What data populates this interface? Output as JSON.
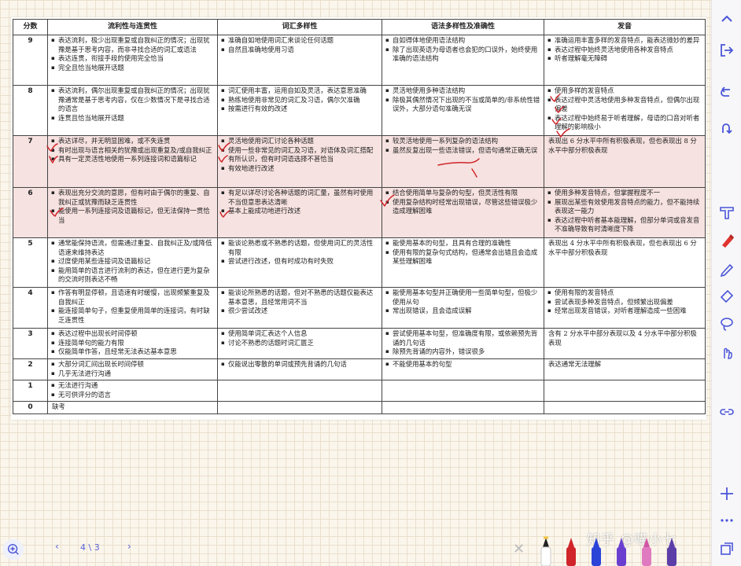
{
  "table": {
    "headers": [
      "分数",
      "流利性与连贯性",
      "词汇多样性",
      "语法多样性及准确性",
      "发音"
    ],
    "rows": [
      {
        "score": "9",
        "highlight": false,
        "fluency": [
          "表达流利，极少出现重复或自我纠正的情况；出现犹豫是基于思考内容，而非寻找合适的词汇或语法",
          "表达连贯，衔接手段的使用完全恰当",
          "完全且恰当地展开话题"
        ],
        "lexical": [
          "准确自如地使用词汇来谈论任何话题",
          "自然且准确地使用习语"
        ],
        "grammar": [
          "自如得体地使用语法结构",
          "除了出现英语为母语者也会犯的口误外，始终使用准确的语法结构"
        ],
        "pron": [
          "准确运用丰富多样的发音特点，能表达微妙的差异",
          "表达过程中始终灵活地使用各种发音特点",
          "听者理解毫无障碍"
        ]
      },
      {
        "score": "8",
        "highlight": false,
        "fluency": [
          "表达流利，偶尔出现重复或自我纠正的情况；出现犹豫通常是基于思考内容，仅在少数情况下是寻找合适的语言",
          "连贯且恰当地展开话题"
        ],
        "lexical": [
          "词汇使用丰富，运用自如及灵活，表达意思准确",
          "熟练地使用非常见的词汇及习语，偶尔欠准确",
          "按需进行有效的改述"
        ],
        "grammar": [
          "灵活地使用多种语法结构",
          "除极其偶然情况下出现的不当或简单的/非系统性错误外，大部分语句准确无误"
        ],
        "pron": [
          "使用多样的发音特点",
          "表达过程中灵活地使用多种发音特点，但偶尔出现偏差",
          "表达过程中始终易于听者理解，母语的口音对听者理解的影响极小"
        ]
      },
      {
        "score": "7",
        "highlight": true,
        "fluency": [
          "表达详尽，并无明显困难，或不失连贯",
          "有时出现与语言相关的犹豫或出现重复及/或自我纠正",
          "具有一定灵活性地使用一系列连接词和语篇标记"
        ],
        "lexical": [
          "灵活地使用词汇讨论各种话题",
          "使用一些非常见的词汇及习语，对语体及词汇搭配有所认识，但有时词语选择不甚恰当",
          "有效地进行改述"
        ],
        "grammar": [
          "较灵活地使用一系列复杂的语法结构",
          "虽然反复出现一些语法错误，但语句通常正确无误"
        ],
        "pron_plain": "表现出 6 分水平中所有积极表现，但也表现出 8 分水平中部分积极表现"
      },
      {
        "score": "6",
        "highlight": true,
        "fluency": [
          "表现出充分交流的意愿，但有时由于偶尔的重复、自我纠正或犹豫而缺乏连贯性",
          "能使用一系列连接词及语篇标记，但无法保持一贯恰当"
        ],
        "lexical": [
          "有足以详尽讨论各种话题的词汇量，虽然有时使用不当但意思表达清晰",
          "基本上能成功地进行改述"
        ],
        "grammar": [
          "结合使用简单与复杂的句型，但灵活性有限",
          "使用复杂结构时经常出现错误，尽管这些错误极少造成理解困难"
        ],
        "pron": [
          "使用多种发音特点，但掌握程度不一",
          "展现出某些有效使用发音特点的能力，但不能持续表现这一能力",
          "表达过程中听者基本能理解，但部分单词或音发音不准确导致有时清晰度下降"
        ]
      },
      {
        "score": "5",
        "highlight": false,
        "fluency": [
          "通常能保持语流，但需通过重复、自我纠正及/或降低语速来维持表达",
          "过度使用某些连接词及语篇标记",
          "能用简单的语言进行流利的表达，但在进行更为复杂的交流时则表达不畅"
        ],
        "lexical": [
          "能谈论熟悉或不熟悉的话题，但使用词汇的灵活性有限",
          "尝试进行改述，但有时成功有时失败"
        ],
        "grammar": [
          "能使用基本的句型，且具有合理的准确性",
          "使用有限的复杂句式结构，但通常会出错且会造成某些理解困难"
        ],
        "pron_plain": "表现出 4 分水平中所有积极表现，但也表现出 6 分水平中部分积极表现"
      },
      {
        "score": "4",
        "highlight": false,
        "fluency": [
          "作答有明显停顿，且语速有时缓慢，出现频繁重复及自我纠正",
          "能连接简单句子，但重复使用简单的连接词，有时缺乏连贯性"
        ],
        "lexical": [
          "能谈论所熟悉的话题，但对不熟悉的话题仅能表达基本意思，且经常用词不当",
          "很少尝试改述"
        ],
        "grammar": [
          "能使用基本句型并正确使用一些简单句型，但极少使用从句",
          "常出现错误，且会造成误解"
        ],
        "pron": [
          "使用有限的发音特点",
          "尝试表现多种发音特点，但频繁出现偏差",
          "经常出现发音错误，对听者理解造成一些困难"
        ]
      },
      {
        "score": "3",
        "highlight": false,
        "fluency": [
          "表达过程中出现长时间停顿",
          "连接简单句的能力有限",
          "仅能简单作答，且经常无法表达基本意思"
        ],
        "lexical": [
          "使用简单词汇表达个人信息",
          "讨论不熟悉的话题时词汇匮乏"
        ],
        "grammar": [
          "尝试使用基本句型，但准确度有限，或依赖预先背诵的几句话",
          "除预先背诵的内容外，错误很多"
        ],
        "pron_plain": "含有 2 分水平中部分表现以及 4 分水平中部分积极表现"
      },
      {
        "score": "2",
        "highlight": false,
        "fluency": [
          "大部分词汇间出现长时间停顿",
          "几乎无法进行沟通"
        ],
        "lexical": [
          "仅能说出零散的单词或预先背诵的几句话"
        ],
        "grammar": [
          "不能使用基本的句型"
        ],
        "pron_plain": "表达通常无法理解"
      },
      {
        "score": "1",
        "highlight": false,
        "fluency": [
          "无法进行沟通",
          "无可供评分的语言"
        ],
        "lexical": [],
        "grammar": [],
        "pron": []
      },
      {
        "score": "0",
        "highlight": false,
        "fluency_plain": "缺考",
        "lexical": [],
        "grammar": [],
        "pron": []
      }
    ]
  },
  "nav": {
    "page": "4 \\ 3"
  },
  "watermark": "知乎 @喵小七",
  "colors": {
    "ink": "#d0242a",
    "highlight": "#f6e2e0",
    "accent": "#4a55d8",
    "paper": "#fbf6ec"
  },
  "toolbar_icons": [
    "chevron-up-icon",
    "export-icon",
    "undo-icon",
    "redo-icon",
    "ruler-icon",
    "marker-icon",
    "pen-icon",
    "eraser-icon",
    "lasso-icon",
    "finger-icon",
    "link-icon",
    "add-page-icon",
    "more-icon",
    "pages-icon"
  ]
}
